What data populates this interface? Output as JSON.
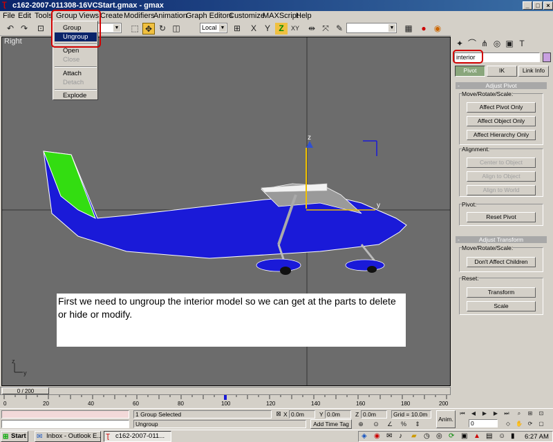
{
  "window": {
    "title": "c162-2007-011308-16VCStart.gmax - gmax"
  },
  "menubar": {
    "items": [
      "File",
      "Edit",
      "Tools",
      "Group",
      "Views",
      "Create",
      "Modifiers",
      "Animation",
      "Graph Editors",
      "Customize",
      "MAXScript",
      "Help"
    ]
  },
  "toolbar": {
    "coord_system": "Local",
    "selection_set": ""
  },
  "group_menu": {
    "items": [
      {
        "label": "Group",
        "state": "normal"
      },
      {
        "label": "Ungroup",
        "state": "selected"
      },
      {
        "label": "Open",
        "state": "normal"
      },
      {
        "label": "Close",
        "state": "disabled"
      },
      {
        "label": "Attach",
        "state": "normal"
      },
      {
        "label": "Detach",
        "state": "disabled"
      },
      {
        "label": "Explode",
        "state": "normal"
      }
    ]
  },
  "viewport": {
    "label": "Right",
    "gizmo_z": "z",
    "gizmo_y": "y",
    "axis_z": "z",
    "axis_y": "y"
  },
  "note": {
    "text": "First we need to ungroup the interior model so we can get at the parts to delete or hide or modify."
  },
  "command_panel": {
    "object_name": "interior",
    "object_color": "#c8a0e0",
    "tabs": [
      "Pivot",
      "IK",
      "Link Info"
    ],
    "adjust_pivot": {
      "title": "Adjust Pivot",
      "move_label": "Move/Rotate/Scale:",
      "buttons": [
        "Affect Pivot Only",
        "Affect Object Only",
        "Affect Hierarchy Only"
      ],
      "alignment_label": "Alignment:",
      "align_buttons": [
        "Center to Object",
        "Align to Object",
        "Align to World"
      ],
      "pivot_label": "Pivot:",
      "reset_pivot": "Reset Pivot"
    },
    "adjust_transform": {
      "title": "Adjust Transform",
      "move_label": "Move/Rotate/Scale:",
      "dont_affect": "Don't Affect Children",
      "reset_label": "Reset:",
      "transform": "Transform",
      "scale": "Scale"
    },
    "minus": "-"
  },
  "timeline": {
    "frame": "0 / 200",
    "ticks": [
      "0",
      "20",
      "40",
      "60",
      "80",
      "100",
      "120",
      "140",
      "160",
      "180",
      "200"
    ]
  },
  "status": {
    "selection": "1 Group Selected",
    "prompt": "Ungroup",
    "x_label": "X",
    "x": "0.0m",
    "y_label": "Y",
    "y": "0.0m",
    "z_label": "Z",
    "z": "0.0m",
    "grid": "Grid = 10.0m",
    "add_time_tag": "Add Time Tag",
    "anim": "Anim.",
    "frame_field": "0"
  },
  "taskbar": {
    "start": "Start",
    "tasks": [
      "Inbox - Outlook E...",
      "c162-2007-011..."
    ],
    "clock": "6:27 AM"
  },
  "colors": {
    "highlight": "#d00000",
    "selection": "#0a246a",
    "fuselage": "#1a1ad8",
    "tail": "#33dd11"
  }
}
